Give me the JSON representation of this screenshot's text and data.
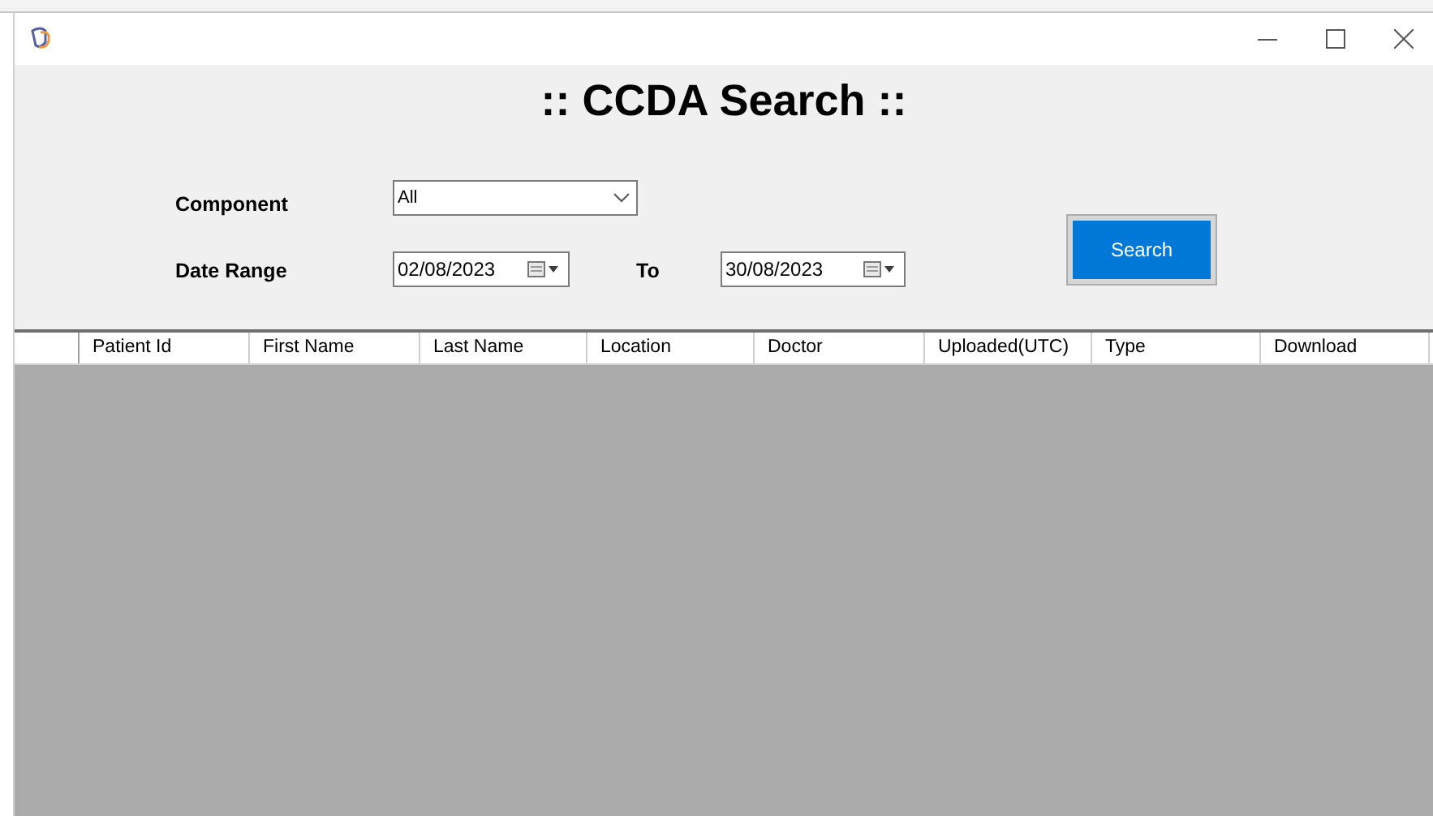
{
  "window": {
    "title": ":: CCDA Search ::"
  },
  "form": {
    "component": {
      "label": "Component",
      "value": "All"
    },
    "date_range": {
      "label": "Date Range",
      "from": "02/08/2023",
      "to_label": "To",
      "to": "30/08/2023"
    },
    "search_button": "Search"
  },
  "table": {
    "columns": [
      "Patient Id",
      "First Name",
      "Last Name",
      "Location",
      "Doctor",
      "Uploaded(UTC)",
      "Type",
      "Download"
    ]
  }
}
